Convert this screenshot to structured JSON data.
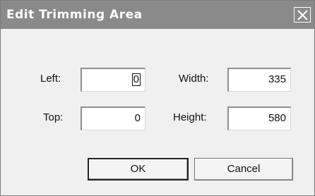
{
  "window": {
    "title": "Edit Trimming Area"
  },
  "fields": {
    "left": {
      "label": "Left:",
      "value": "0"
    },
    "top": {
      "label": "Top:",
      "value": "0"
    },
    "width": {
      "label": "Width:",
      "value": "335"
    },
    "height": {
      "label": "Height:",
      "value": "580"
    }
  },
  "buttons": {
    "ok": "OK",
    "cancel": "Cancel"
  },
  "icons": {
    "close": "close-icon"
  }
}
